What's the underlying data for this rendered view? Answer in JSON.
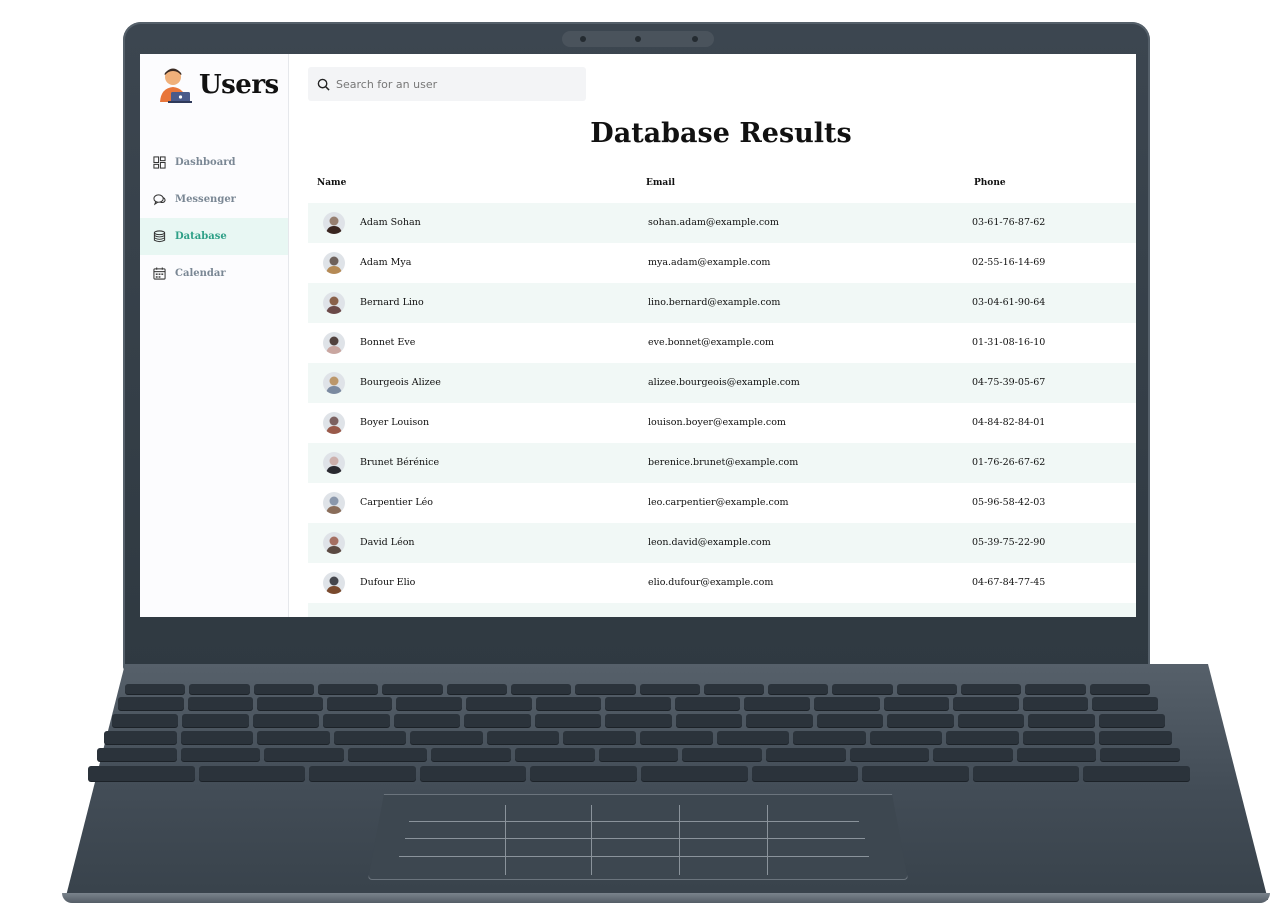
{
  "sidebar": {
    "app_title": "Users",
    "items": [
      {
        "label": "Dashboard",
        "icon": "dashboard-icon",
        "active": false
      },
      {
        "label": "Messenger",
        "icon": "chat-icon",
        "active": false
      },
      {
        "label": "Database",
        "icon": "database-icon",
        "active": true
      },
      {
        "label": "Calendar",
        "icon": "calendar-icon",
        "active": false
      }
    ]
  },
  "search": {
    "placeholder": "Search for an user",
    "value": ""
  },
  "main": {
    "title": "Database Results",
    "columns": {
      "name": "Name",
      "email": "Email",
      "phone": "Phone"
    },
    "rows": [
      {
        "name": "Adam Sohan",
        "email": "sohan.adam@example.com",
        "phone": "03-61-76-87-62"
      },
      {
        "name": "Adam Mya",
        "email": "mya.adam@example.com",
        "phone": "02-55-16-14-69"
      },
      {
        "name": "Bernard Lino",
        "email": "lino.bernard@example.com",
        "phone": "03-04-61-90-64"
      },
      {
        "name": "Bonnet Eve",
        "email": "eve.bonnet@example.com",
        "phone": "01-31-08-16-10"
      },
      {
        "name": "Bourgeois Alizee",
        "email": "alizee.bourgeois@example.com",
        "phone": "04-75-39-05-67"
      },
      {
        "name": "Boyer Louison",
        "email": "louison.boyer@example.com",
        "phone": "04-84-82-84-01"
      },
      {
        "name": "Brunet Bérénice",
        "email": "berenice.brunet@example.com",
        "phone": "01-76-26-67-62"
      },
      {
        "name": "Carpentier Léo",
        "email": "leo.carpentier@example.com",
        "phone": "05-96-58-42-03"
      },
      {
        "name": "David Léon",
        "email": "leon.david@example.com",
        "phone": "05-39-75-22-90"
      },
      {
        "name": "Dufour Elio",
        "email": "elio.dufour@example.com",
        "phone": "04-67-84-77-45"
      }
    ]
  },
  "colors": {
    "accent": "#2ea087",
    "active_bg": "#e8f7f3",
    "row_shade": "#f1f8f6",
    "nav_text": "#7a8794"
  }
}
